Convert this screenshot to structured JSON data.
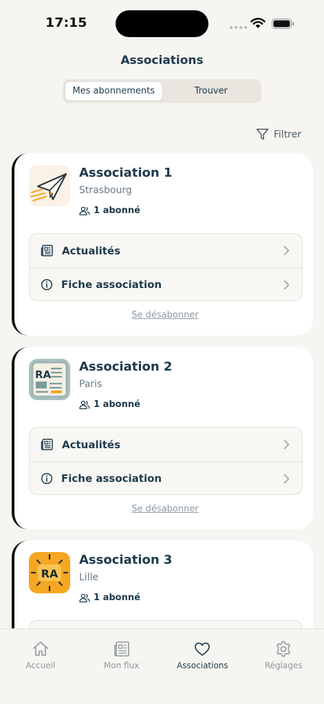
{
  "status": {
    "time": "17:15"
  },
  "header": {
    "title": "Associations",
    "segments": [
      "Mes abonnements",
      "Trouver"
    ],
    "filter_label": "Filtrer"
  },
  "cards": [
    {
      "name": "Association 1",
      "city": "Strasbourg",
      "subscribers": "1 abonné",
      "logo": "paper-plane-logo"
    },
    {
      "name": "Association 2",
      "city": "Paris",
      "subscribers": "1 abonné",
      "logo": "ra-newspaper-logo"
    },
    {
      "name": "Association 3",
      "city": "Lille",
      "subscribers": "1 abonné",
      "logo": "ra-sun-logo"
    }
  ],
  "card_actions": {
    "news": "Actualités",
    "info": "Fiche association",
    "unsubscribe": "Se désabonner"
  },
  "logo_text": "RA",
  "tabs": [
    "Accueil",
    "Mon flux",
    "Associations",
    "Réglages"
  ],
  "colors": {
    "primary": "#1e3a4c",
    "background": "#f7f5f1",
    "accent": "#f5a623"
  }
}
